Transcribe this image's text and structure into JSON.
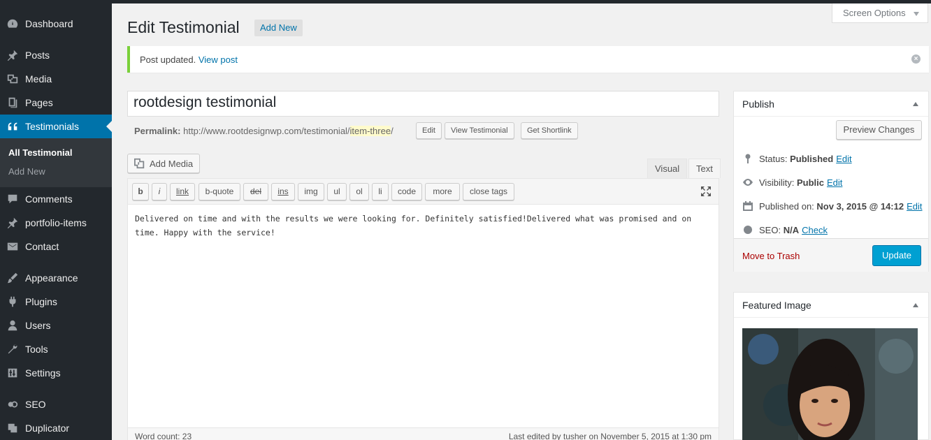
{
  "sidebar": {
    "items": [
      {
        "label": "Dashboard",
        "icon": "dashboard-icon"
      },
      {
        "label": "Posts",
        "icon": "pin-icon"
      },
      {
        "label": "Media",
        "icon": "media-icon"
      },
      {
        "label": "Pages",
        "icon": "pages-icon"
      },
      {
        "label": "Testimonials",
        "icon": "quote-icon"
      },
      {
        "label": "Comments",
        "icon": "comment-icon"
      },
      {
        "label": "portfolio-items",
        "icon": "pin-icon"
      },
      {
        "label": "Contact",
        "icon": "mail-icon"
      },
      {
        "label": "Appearance",
        "icon": "brush-icon"
      },
      {
        "label": "Plugins",
        "icon": "plugin-icon"
      },
      {
        "label": "Users",
        "icon": "user-icon"
      },
      {
        "label": "Tools",
        "icon": "wrench-icon"
      },
      {
        "label": "Settings",
        "icon": "sliders-icon"
      },
      {
        "label": "SEO",
        "icon": "seo-icon"
      },
      {
        "label": "Duplicator",
        "icon": "duplicator-icon"
      }
    ],
    "submenu": {
      "active": "All Testimonial",
      "add_new": "Add New"
    }
  },
  "header": {
    "title": "Edit Testimonial",
    "add_new": "Add New",
    "screen_options": "Screen Options"
  },
  "notice": {
    "text": "Post updated.",
    "link": "View post"
  },
  "post": {
    "title": "rootdesign testimonial",
    "permalink_label": "Permalink:",
    "permalink_base": "http://www.rootdesignwp.com/testimonial/",
    "permalink_slug": "item-three",
    "permalink_trailing": "/",
    "edit_btn": "Edit",
    "view_btn": "View Testimonial",
    "shortlink_btn": "Get Shortlink"
  },
  "editor": {
    "add_media": "Add Media",
    "tab_visual": "Visual",
    "tab_text": "Text",
    "toolbar": [
      "b",
      "i",
      "link",
      "b-quote",
      "del",
      "ins",
      "img",
      "ul",
      "ol",
      "li",
      "code",
      "more",
      "close tags"
    ],
    "content": "Delivered on time and with the results we were looking for. Definitely satisfied!Delivered what was promised and on time. Happy with the service!",
    "word_count": "Word count: 23",
    "last_edited": "Last edited by tusher on November 5, 2015 at 1:30 pm"
  },
  "publish": {
    "title": "Publish",
    "preview": "Preview Changes",
    "status_label": "Status:",
    "status_value": "Published",
    "visibility_label": "Visibility:",
    "visibility_value": "Public",
    "published_label": "Published on:",
    "published_value": "Nov 3, 2015 @ 14:12",
    "seo_label": "SEO:",
    "seo_value": "N/A",
    "seo_link": "Check",
    "edit": "Edit",
    "trash": "Move to Trash",
    "update": "Update"
  },
  "featured": {
    "title": "Featured Image"
  },
  "colors": {
    "accent": "#0073aa",
    "sidebar": "#23282d",
    "notice": "#7ad03a",
    "update": "#00a0d2"
  }
}
